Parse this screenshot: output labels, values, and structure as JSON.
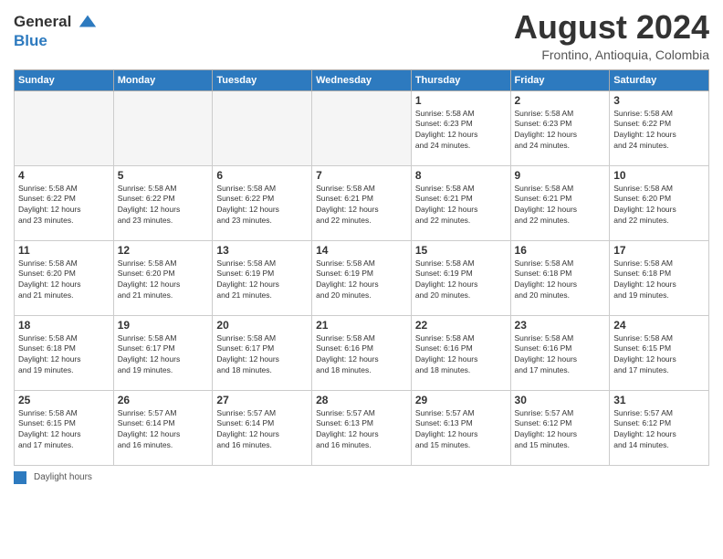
{
  "logo": {
    "line1": "General",
    "line2": "Blue"
  },
  "header": {
    "title": "August 2024",
    "subtitle": "Frontino, Antioquia, Colombia"
  },
  "days_of_week": [
    "Sunday",
    "Monday",
    "Tuesday",
    "Wednesday",
    "Thursday",
    "Friday",
    "Saturday"
  ],
  "weeks": [
    [
      {
        "day": "",
        "info": ""
      },
      {
        "day": "",
        "info": ""
      },
      {
        "day": "",
        "info": ""
      },
      {
        "day": "",
        "info": ""
      },
      {
        "day": "1",
        "info": "Sunrise: 5:58 AM\nSunset: 6:23 PM\nDaylight: 12 hours\nand 24 minutes."
      },
      {
        "day": "2",
        "info": "Sunrise: 5:58 AM\nSunset: 6:23 PM\nDaylight: 12 hours\nand 24 minutes."
      },
      {
        "day": "3",
        "info": "Sunrise: 5:58 AM\nSunset: 6:22 PM\nDaylight: 12 hours\nand 24 minutes."
      }
    ],
    [
      {
        "day": "4",
        "info": "Sunrise: 5:58 AM\nSunset: 6:22 PM\nDaylight: 12 hours\nand 23 minutes."
      },
      {
        "day": "5",
        "info": "Sunrise: 5:58 AM\nSunset: 6:22 PM\nDaylight: 12 hours\nand 23 minutes."
      },
      {
        "day": "6",
        "info": "Sunrise: 5:58 AM\nSunset: 6:22 PM\nDaylight: 12 hours\nand 23 minutes."
      },
      {
        "day": "7",
        "info": "Sunrise: 5:58 AM\nSunset: 6:21 PM\nDaylight: 12 hours\nand 22 minutes."
      },
      {
        "day": "8",
        "info": "Sunrise: 5:58 AM\nSunset: 6:21 PM\nDaylight: 12 hours\nand 22 minutes."
      },
      {
        "day": "9",
        "info": "Sunrise: 5:58 AM\nSunset: 6:21 PM\nDaylight: 12 hours\nand 22 minutes."
      },
      {
        "day": "10",
        "info": "Sunrise: 5:58 AM\nSunset: 6:20 PM\nDaylight: 12 hours\nand 22 minutes."
      }
    ],
    [
      {
        "day": "11",
        "info": "Sunrise: 5:58 AM\nSunset: 6:20 PM\nDaylight: 12 hours\nand 21 minutes."
      },
      {
        "day": "12",
        "info": "Sunrise: 5:58 AM\nSunset: 6:20 PM\nDaylight: 12 hours\nand 21 minutes."
      },
      {
        "day": "13",
        "info": "Sunrise: 5:58 AM\nSunset: 6:19 PM\nDaylight: 12 hours\nand 21 minutes."
      },
      {
        "day": "14",
        "info": "Sunrise: 5:58 AM\nSunset: 6:19 PM\nDaylight: 12 hours\nand 20 minutes."
      },
      {
        "day": "15",
        "info": "Sunrise: 5:58 AM\nSunset: 6:19 PM\nDaylight: 12 hours\nand 20 minutes."
      },
      {
        "day": "16",
        "info": "Sunrise: 5:58 AM\nSunset: 6:18 PM\nDaylight: 12 hours\nand 20 minutes."
      },
      {
        "day": "17",
        "info": "Sunrise: 5:58 AM\nSunset: 6:18 PM\nDaylight: 12 hours\nand 19 minutes."
      }
    ],
    [
      {
        "day": "18",
        "info": "Sunrise: 5:58 AM\nSunset: 6:18 PM\nDaylight: 12 hours\nand 19 minutes."
      },
      {
        "day": "19",
        "info": "Sunrise: 5:58 AM\nSunset: 6:17 PM\nDaylight: 12 hours\nand 19 minutes."
      },
      {
        "day": "20",
        "info": "Sunrise: 5:58 AM\nSunset: 6:17 PM\nDaylight: 12 hours\nand 18 minutes."
      },
      {
        "day": "21",
        "info": "Sunrise: 5:58 AM\nSunset: 6:16 PM\nDaylight: 12 hours\nand 18 minutes."
      },
      {
        "day": "22",
        "info": "Sunrise: 5:58 AM\nSunset: 6:16 PM\nDaylight: 12 hours\nand 18 minutes."
      },
      {
        "day": "23",
        "info": "Sunrise: 5:58 AM\nSunset: 6:16 PM\nDaylight: 12 hours\nand 17 minutes."
      },
      {
        "day": "24",
        "info": "Sunrise: 5:58 AM\nSunset: 6:15 PM\nDaylight: 12 hours\nand 17 minutes."
      }
    ],
    [
      {
        "day": "25",
        "info": "Sunrise: 5:58 AM\nSunset: 6:15 PM\nDaylight: 12 hours\nand 17 minutes."
      },
      {
        "day": "26",
        "info": "Sunrise: 5:57 AM\nSunset: 6:14 PM\nDaylight: 12 hours\nand 16 minutes."
      },
      {
        "day": "27",
        "info": "Sunrise: 5:57 AM\nSunset: 6:14 PM\nDaylight: 12 hours\nand 16 minutes."
      },
      {
        "day": "28",
        "info": "Sunrise: 5:57 AM\nSunset: 6:13 PM\nDaylight: 12 hours\nand 16 minutes."
      },
      {
        "day": "29",
        "info": "Sunrise: 5:57 AM\nSunset: 6:13 PM\nDaylight: 12 hours\nand 15 minutes."
      },
      {
        "day": "30",
        "info": "Sunrise: 5:57 AM\nSunset: 6:12 PM\nDaylight: 12 hours\nand 15 minutes."
      },
      {
        "day": "31",
        "info": "Sunrise: 5:57 AM\nSunset: 6:12 PM\nDaylight: 12 hours\nand 14 minutes."
      }
    ]
  ],
  "footer": {
    "swatch_label": "Daylight hours"
  }
}
